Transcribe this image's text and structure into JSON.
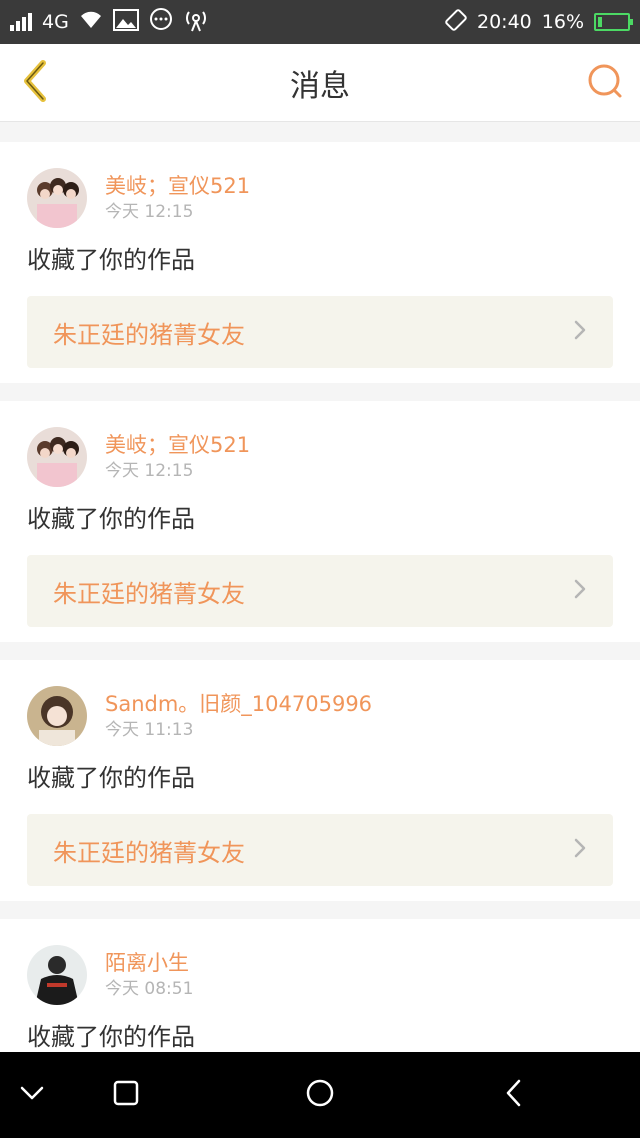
{
  "status_bar": {
    "network": "4G",
    "time": "20:40",
    "battery": "16%",
    "battery_level": 0.16,
    "icons": [
      "signal-icon",
      "wifi-icon",
      "image-icon",
      "chat-icon",
      "hotspot-icon",
      "rotate-icon",
      "battery-icon"
    ]
  },
  "header": {
    "title": "消息",
    "back_icon": "chevron-left-icon",
    "search_icon": "search-icon"
  },
  "messages": [
    {
      "user": "美岐；宣仪521",
      "time": "今天 12:15",
      "action": "收藏了你的作品",
      "work": "朱正廷的猪菁女友"
    },
    {
      "user": "美岐；宣仪521",
      "time": "今天 12:15",
      "action": "收藏了你的作品",
      "work": "朱正廷的猪菁女友"
    },
    {
      "user": "Sandm。旧颜_104705996",
      "time": "今天 11:13",
      "action": "收藏了你的作品",
      "work": "朱正廷的猪菁女友"
    },
    {
      "user": "陌离小生",
      "time": "今天 08:51",
      "action": "收藏了你的作品",
      "work": ""
    }
  ],
  "colors": {
    "accent": "#f0955a",
    "back_arrow": "#e6c13c",
    "work_bg": "#f5f4ec"
  },
  "nav_bar": [
    "chevron-down-icon",
    "recent-apps-icon",
    "home-icon",
    "back-icon"
  ]
}
